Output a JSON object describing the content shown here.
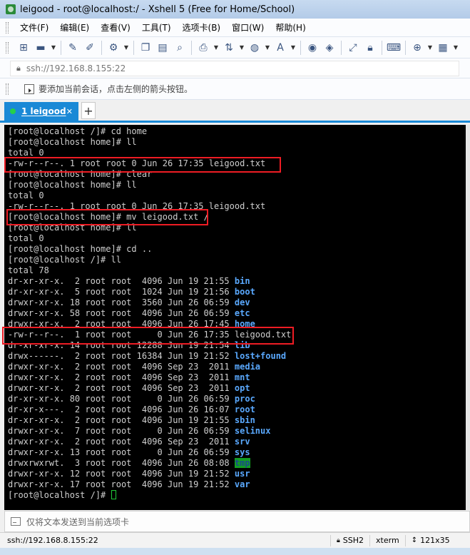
{
  "window": {
    "title": "leigood - root@localhost:/ - Xshell 5 (Free for Home/School)"
  },
  "menu": [
    "文件(F)",
    "编辑(E)",
    "查看(V)",
    "工具(T)",
    "选项卡(B)",
    "窗口(W)",
    "帮助(H)"
  ],
  "toolbar": {
    "icons": [
      "new-session-icon",
      "open-folder-icon",
      "disconnect-icon",
      "reconnect-icon",
      "properties-icon",
      "copy-icon",
      "paste-icon",
      "find-icon",
      "print-icon",
      "transfer-icon",
      "globe-icon",
      "font-icon",
      "script-icon",
      "xftp-icon",
      "fullscreen-icon",
      "lock-icon",
      "keyboard-icon",
      "add-icon",
      "layout-icon"
    ]
  },
  "address": {
    "value": "ssh://192.168.8.155:22"
  },
  "hint": {
    "text": "要添加当前会话，点击左侧的箭头按钮。"
  },
  "tab": {
    "label": "1 leigood",
    "close": "✕",
    "add": "+"
  },
  "terminal": {
    "lines": [
      [
        {
          "t": "[root@localhost /]# cd home"
        }
      ],
      [
        {
          "t": "[root@localhost home]# ll"
        }
      ],
      [
        {
          "t": "total 0"
        }
      ],
      [
        {
          "t": "-rw-r--r--. 1 root root 0 Jun 26 17:35 leigood.txt"
        }
      ],
      [
        {
          "t": "[root@localhost home]# clear"
        }
      ],
      [
        {
          "t": "[root@localhost home]# ll"
        }
      ],
      [
        {
          "t": "total 0"
        }
      ],
      [
        {
          "t": "-rw-r--r--. 1 root root 0 Jun 26 17:35 leigood.txt"
        }
      ],
      [
        {
          "t": "[root@localhost home]# mv leigood.txt /"
        }
      ],
      [
        {
          "t": "[root@localhost home]# ll"
        }
      ],
      [
        {
          "t": "total 0"
        }
      ],
      [
        {
          "t": "[root@localhost home]# cd .."
        }
      ],
      [
        {
          "t": "[root@localhost /]# ll"
        }
      ],
      [
        {
          "t": "total 78"
        }
      ],
      [
        {
          "t": "dr-xr-xr-x.  2 root root  4096 Jun 19 21:55 "
        },
        {
          "t": "bin",
          "c": "dir"
        }
      ],
      [
        {
          "t": "dr-xr-xr-x.  5 root root  1024 Jun 19 21:56 "
        },
        {
          "t": "boot",
          "c": "dir"
        }
      ],
      [
        {
          "t": "drwxr-xr-x. 18 root root  3560 Jun 26 06:59 "
        },
        {
          "t": "dev",
          "c": "dir"
        }
      ],
      [
        {
          "t": "drwxr-xr-x. 58 root root  4096 Jun 26 06:59 "
        },
        {
          "t": "etc",
          "c": "dir"
        }
      ],
      [
        {
          "t": "drwxr-xr-x.  2 root root  4096 Jun 26 17:45 "
        },
        {
          "t": "home",
          "c": "dir"
        }
      ],
      [
        {
          "t": "-rw-r--r--.  1 root root     0 Jun 26 17:35 leigood.txt"
        }
      ],
      [
        {
          "t": "dr-xr-xr-x. 14 root root 12288 Jun 19 21:54 "
        },
        {
          "t": "lib",
          "c": "dir"
        }
      ],
      [
        {
          "t": "drwx------.  2 root root 16384 Jun 19 21:52 "
        },
        {
          "t": "lost+found",
          "c": "dir"
        }
      ],
      [
        {
          "t": "drwxr-xr-x.  2 root root  4096 Sep 23  2011 "
        },
        {
          "t": "media",
          "c": "dir"
        }
      ],
      [
        {
          "t": "drwxr-xr-x.  2 root root  4096 Sep 23  2011 "
        },
        {
          "t": "mnt",
          "c": "dir"
        }
      ],
      [
        {
          "t": "drwxr-xr-x.  2 root root  4096 Sep 23  2011 "
        },
        {
          "t": "opt",
          "c": "dir"
        }
      ],
      [
        {
          "t": "dr-xr-xr-x. 80 root root     0 Jun 26 06:59 "
        },
        {
          "t": "proc",
          "c": "dir"
        }
      ],
      [
        {
          "t": "dr-xr-x---.  2 root root  4096 Jun 26 16:07 "
        },
        {
          "t": "root",
          "c": "dir"
        }
      ],
      [
        {
          "t": "dr-xr-xr-x.  2 root root  4096 Jun 19 21:55 "
        },
        {
          "t": "sbin",
          "c": "dir"
        }
      ],
      [
        {
          "t": "drwxr-xr-x.  7 root root     0 Jun 26 06:59 "
        },
        {
          "t": "selinux",
          "c": "dir"
        }
      ],
      [
        {
          "t": "drwxr-xr-x.  2 root root  4096 Sep 23  2011 "
        },
        {
          "t": "srv",
          "c": "dir"
        }
      ],
      [
        {
          "t": "drwxr-xr-x. 13 root root     0 Jun 26 06:59 "
        },
        {
          "t": "sys",
          "c": "dir"
        }
      ],
      [
        {
          "t": "drwxrwxrwt.  3 root root  4096 Jun 26 08:08 "
        },
        {
          "t": "tmp",
          "c": "sticky"
        }
      ],
      [
        {
          "t": "drwxr-xr-x. 12 root root  4096 Jun 19 21:52 "
        },
        {
          "t": "usr",
          "c": "dir"
        }
      ],
      [
        {
          "t": "drwxr-xr-x. 17 root root  4096 Jun 19 21:52 "
        },
        {
          "t": "var",
          "c": "dir"
        }
      ],
      [
        {
          "t": "[root@localhost /]# "
        },
        {
          "t": "",
          "c": "cursor"
        }
      ]
    ]
  },
  "sendbar": {
    "placeholder": "仅将文本发送到当前选项卡"
  },
  "status": {
    "host": "ssh://192.168.8.155:22",
    "protocol": "SSH2",
    "terminal_type": "xterm",
    "size": "121x35"
  },
  "colors": {
    "terminal_bg": "#000000",
    "terminal_fg": "#cfcfcf",
    "directory": "#5aa9ff",
    "sticky_bg": "#129d23",
    "tab_accent": "#1a89d6",
    "highlight_box": "#ee1c24"
  }
}
